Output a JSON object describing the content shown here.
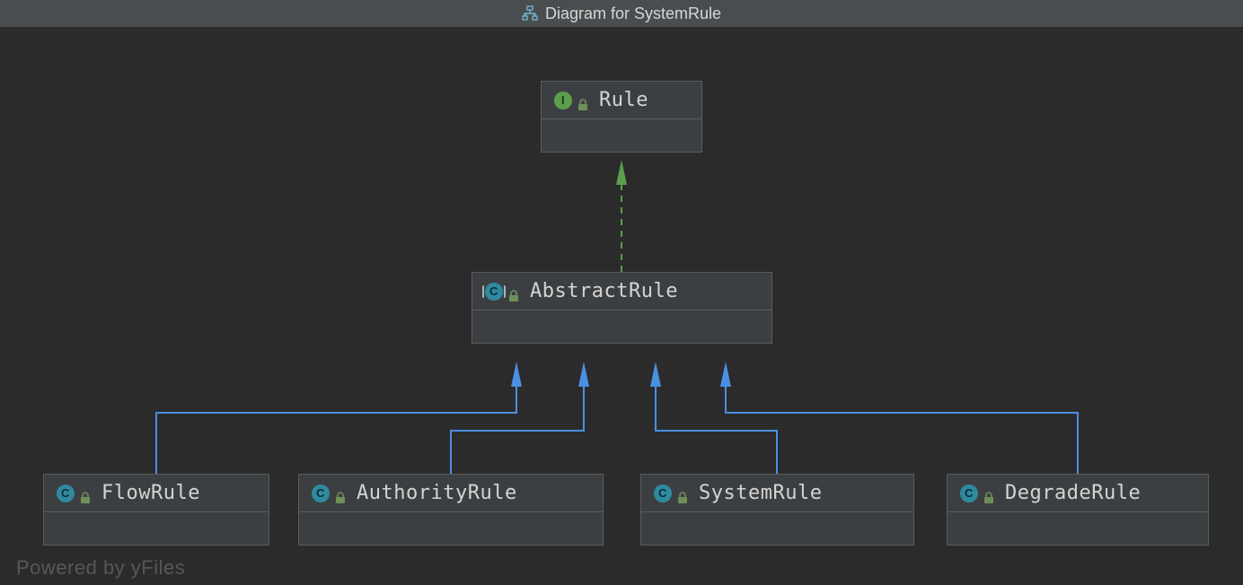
{
  "header": {
    "title": "Diagram for SystemRule",
    "icon": "diagram-hierarchy-icon"
  },
  "nodes": {
    "rule": {
      "name": "Rule",
      "kind": "interface",
      "badge": "I"
    },
    "abstractRule": {
      "name": "AbstractRule",
      "kind": "abstract-class",
      "badge": "C"
    },
    "flowRule": {
      "name": "FlowRule",
      "kind": "class",
      "badge": "C"
    },
    "authorityRule": {
      "name": "AuthorityRule",
      "kind": "class",
      "badge": "C"
    },
    "systemRule": {
      "name": "SystemRule",
      "kind": "class",
      "badge": "C"
    },
    "degradeRule": {
      "name": "DegradeRule",
      "kind": "class",
      "badge": "C"
    }
  },
  "edges": [
    {
      "from": "abstractRule",
      "to": "rule",
      "type": "implements"
    },
    {
      "from": "flowRule",
      "to": "abstractRule",
      "type": "extends"
    },
    {
      "from": "authorityRule",
      "to": "abstractRule",
      "type": "extends"
    },
    {
      "from": "systemRule",
      "to": "abstractRule",
      "type": "extends"
    },
    {
      "from": "degradeRule",
      "to": "abstractRule",
      "type": "extends"
    }
  ],
  "colors": {
    "implements": "#5b9e4d",
    "extends": "#4a90e2",
    "nodeBg": "#3c3f41",
    "nodeBorder": "#5a5d5f",
    "canvasBg": "#2b2b2b",
    "headerBg": "#4a4d4f"
  },
  "watermark": "Powered by yFiles"
}
